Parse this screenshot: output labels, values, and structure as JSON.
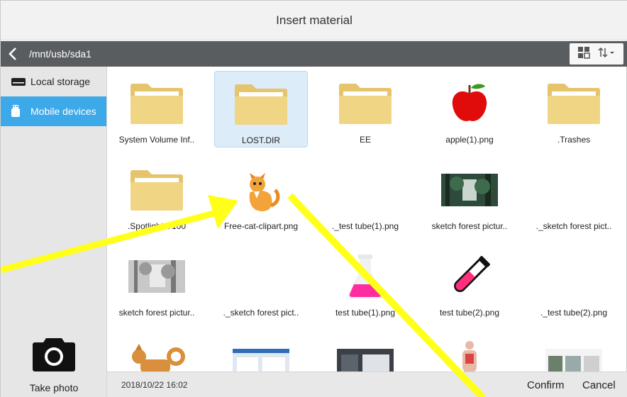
{
  "title": "Insert material",
  "path": "/mnt/usb/sda1",
  "sidebar": {
    "items": [
      {
        "label": "Local storage",
        "icon": "hard-drive-icon",
        "active": false
      },
      {
        "label": "Mobile devices",
        "icon": "usb-icon",
        "active": true
      }
    ],
    "take_photo_label": "Take photo"
  },
  "files": [
    {
      "name": "System Volume Inf..",
      "kind": "folder"
    },
    {
      "name": "LOST.DIR",
      "kind": "folder",
      "selected": true
    },
    {
      "name": "EE",
      "kind": "folder"
    },
    {
      "name": "apple(1).png",
      "kind": "apple"
    },
    {
      "name": ".Trashes",
      "kind": "folder"
    },
    {
      "name": ".Spotlight-V100",
      "kind": "folder"
    },
    {
      "name": "Free-cat-clipart.png",
      "kind": "cat"
    },
    {
      "name": "._test tube(1).png",
      "kind": "blank"
    },
    {
      "name": "sketch forest pictur..",
      "kind": "forest"
    },
    {
      "name": "._sketch forest pict..",
      "kind": "blank"
    },
    {
      "name": "sketch forest pictur..",
      "kind": "sketch"
    },
    {
      "name": "._sketch forest pict..",
      "kind": "blank"
    },
    {
      "name": "test tube(1).png",
      "kind": "flask"
    },
    {
      "name": "test tube(2).png",
      "kind": "tube"
    },
    {
      "name": "._test tube(2).png",
      "kind": "blank"
    },
    {
      "name": "",
      "kind": "dog"
    },
    {
      "name": "",
      "kind": "web"
    },
    {
      "name": "",
      "kind": "darkweb"
    },
    {
      "name": "",
      "kind": "anatomy"
    },
    {
      "name": "",
      "kind": "site"
    }
  ],
  "footer": {
    "date": "2018/10/22 16:02",
    "confirm_label": "Confirm",
    "cancel_label": "Cancel"
  },
  "colors": {
    "accent": "#3ea9e8",
    "pathbar": "#5a5d60",
    "arrow": "#ffff1a"
  }
}
